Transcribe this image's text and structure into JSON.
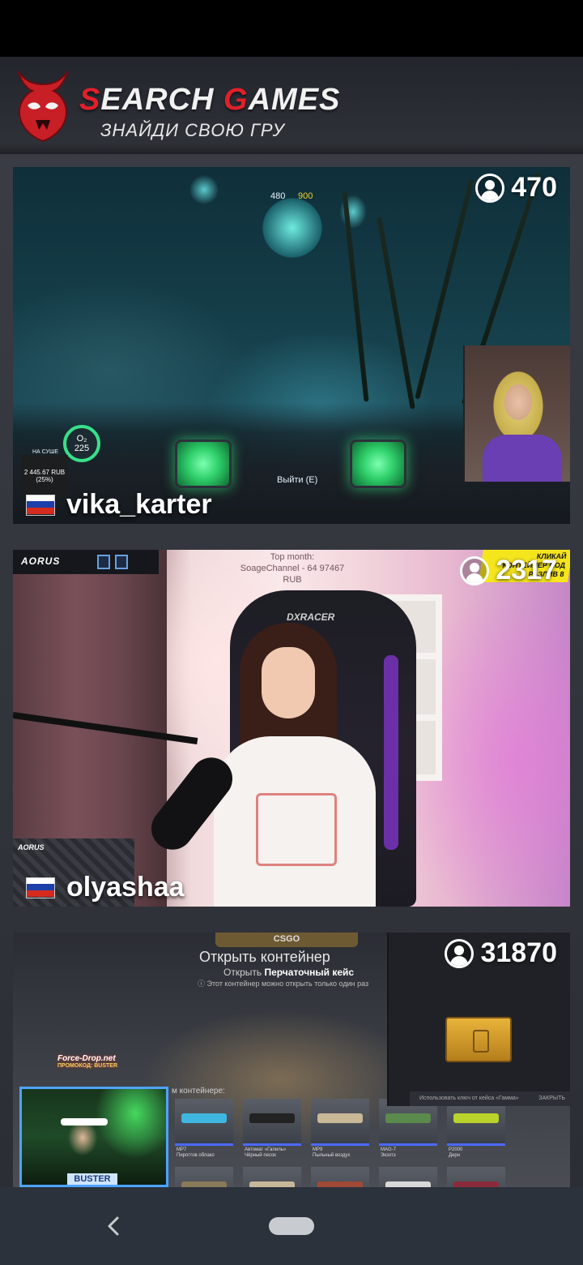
{
  "header": {
    "title_red_1": "S",
    "title_rest_1": "EARCH ",
    "title_red_2": "G",
    "title_rest_2": "AMES",
    "subtitle": "ЗНАЙДИ СВОЮ ГРУ"
  },
  "streams": [
    {
      "streamer": "vika_karter",
      "viewers": "470",
      "flag": "russia-flag",
      "hud": {
        "o2_label": "O₂",
        "o2_value": "225",
        "money": "2 445.67 RUB",
        "money_pct": "(25%)",
        "depth_left": "480",
        "depth_right": "900",
        "exit": "Выйти (E)",
        "surface": "НА СУШЕ"
      }
    },
    {
      "streamer": "olyashaa",
      "viewers": "2317",
      "flag": "russia-flag",
      "overlay": {
        "brand": "AORUS",
        "top_month": "Top month:",
        "top_donor": "SoageChannel - 64 97467 RUB",
        "promo_1": "КЛИКАЙ",
        "promo_2": "КОНТЕЙНЕР ПОД",
        "promo_3": "РАЗЛИВ 8",
        "chair_brand": "DXRACER",
        "board_brand": "AORUS"
      }
    },
    {
      "streamer": "",
      "viewers": "31870",
      "overlay": {
        "crate_label": "CSGO",
        "case_title": "Открыть контейнер",
        "case_sub_prefix": "Открыть ",
        "case_sub_bold": "Перчаточный кейс",
        "case_note": "Этот контейнер можно открыть только один раз",
        "contents_label": "м контейнере:",
        "sponsor": "Force-Drop.net",
        "promo_code": "ПРОМОКОД: BUSTER",
        "key_text": "Использовать ключ от кейса «Гамма»",
        "key_action": "ЗАКРЫТЬ",
        "cam_name": "BUSTER",
        "weapons": [
          {
            "name": "MP7",
            "skin": "Пирогтов облако"
          },
          {
            "name": "Автомат «Галиль»",
            "skin": "Чёрный песок"
          },
          {
            "name": "MP9",
            "skin": "Пыльный воздух"
          },
          {
            "name": "MAG-7",
            "skin": "Экзотэ"
          },
          {
            "name": "P2000",
            "skin": "Дерн"
          }
        ]
      }
    }
  ],
  "colors": {
    "accent_red": "#e0202a",
    "nav_bg": "#2c323b",
    "feed_bg": "#34363e"
  },
  "nav": {
    "back_icon": "back-chevron-icon",
    "home_icon": "home-pill-icon"
  }
}
